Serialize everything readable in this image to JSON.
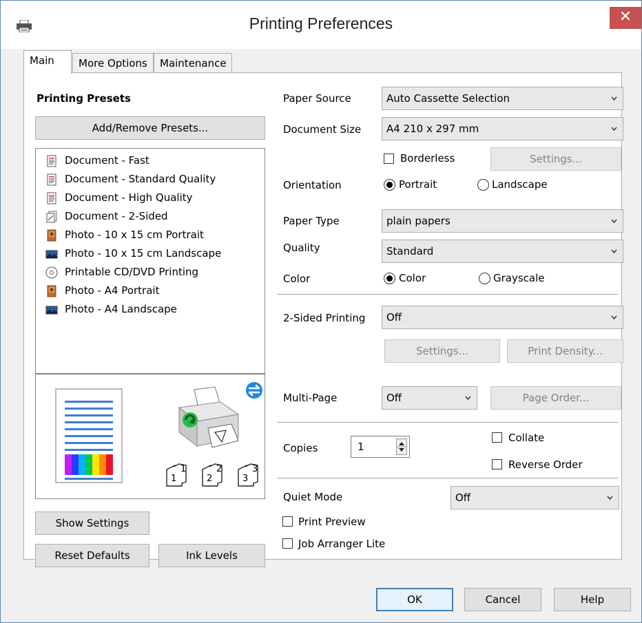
{
  "window": {
    "title": "Printing Preferences",
    "close_glyph": "✕"
  },
  "tabs": [
    {
      "label": "Main",
      "active": true
    },
    {
      "label": "More Options"
    },
    {
      "label": "Maintenance"
    }
  ],
  "presets": {
    "heading": "Printing Presets",
    "add_remove_label": "Add/Remove Presets...",
    "items": [
      {
        "label": "Document - Fast",
        "icon": "document-icon"
      },
      {
        "label": "Document - Standard Quality",
        "icon": "document-icon"
      },
      {
        "label": "Document - High Quality",
        "icon": "document-color-icon"
      },
      {
        "label": "Document - 2-Sided",
        "icon": "document-duplex-icon"
      },
      {
        "label": "Photo - 10 x 15 cm Portrait",
        "icon": "photo-portrait-icon"
      },
      {
        "label": "Photo - 10 x 15 cm Landscape",
        "icon": "photo-landscape-icon"
      },
      {
        "label": "Printable CD/DVD Printing",
        "icon": "disc-icon"
      },
      {
        "label": "Photo - A4 Portrait",
        "icon": "photo-portrait-icon"
      },
      {
        "label": "Photo - A4 Landscape",
        "icon": "photo-landscape-icon"
      }
    ],
    "copy_labels": [
      "1",
      "2",
      "3"
    ],
    "show_settings_label": "Show Settings",
    "reset_defaults_label": "Reset Defaults",
    "ink_levels_label": "Ink Levels"
  },
  "settings": {
    "paper_source_label": "Paper Source",
    "paper_source_value": "Auto Cassette Selection",
    "document_size_label": "Document Size",
    "document_size_value": "A4 210 x 297 mm",
    "borderless_label": "Borderless",
    "borderless_checked": false,
    "borderless_settings_label": "Settings...",
    "orientation_label": "Orientation",
    "portrait_label": "Portrait",
    "landscape_label": "Landscape",
    "orientation_selected": "Portrait",
    "paper_type_label": "Paper Type",
    "paper_type_value": "plain papers",
    "quality_label": "Quality",
    "quality_value": "Standard",
    "color_label": "Color",
    "color_option_label": "Color",
    "grayscale_label": "Grayscale",
    "color_selected": "Color",
    "two_sided_label": "2-Sided Printing",
    "two_sided_value": "Off",
    "two_sided_settings_label": "Settings...",
    "print_density_label": "Print Density...",
    "multi_page_label": "Multi-Page",
    "multi_page_value": "Off",
    "page_order_label": "Page Order...",
    "copies_label": "Copies",
    "copies_value": "1",
    "collate_label": "Collate",
    "collate_checked": false,
    "reverse_order_label": "Reverse Order",
    "reverse_order_checked": false,
    "quiet_mode_label": "Quiet Mode",
    "quiet_mode_value": "Off",
    "print_preview_label": "Print Preview",
    "print_preview_checked": false,
    "job_arranger_label": "Job Arranger Lite",
    "job_arranger_checked": false
  },
  "footer": {
    "ok_label": "OK",
    "cancel_label": "Cancel",
    "help_label": "Help"
  },
  "colors": {
    "close_button": "#c75050",
    "window_border": "#5f86b0",
    "dialog_bg": "#f0f0f0"
  }
}
